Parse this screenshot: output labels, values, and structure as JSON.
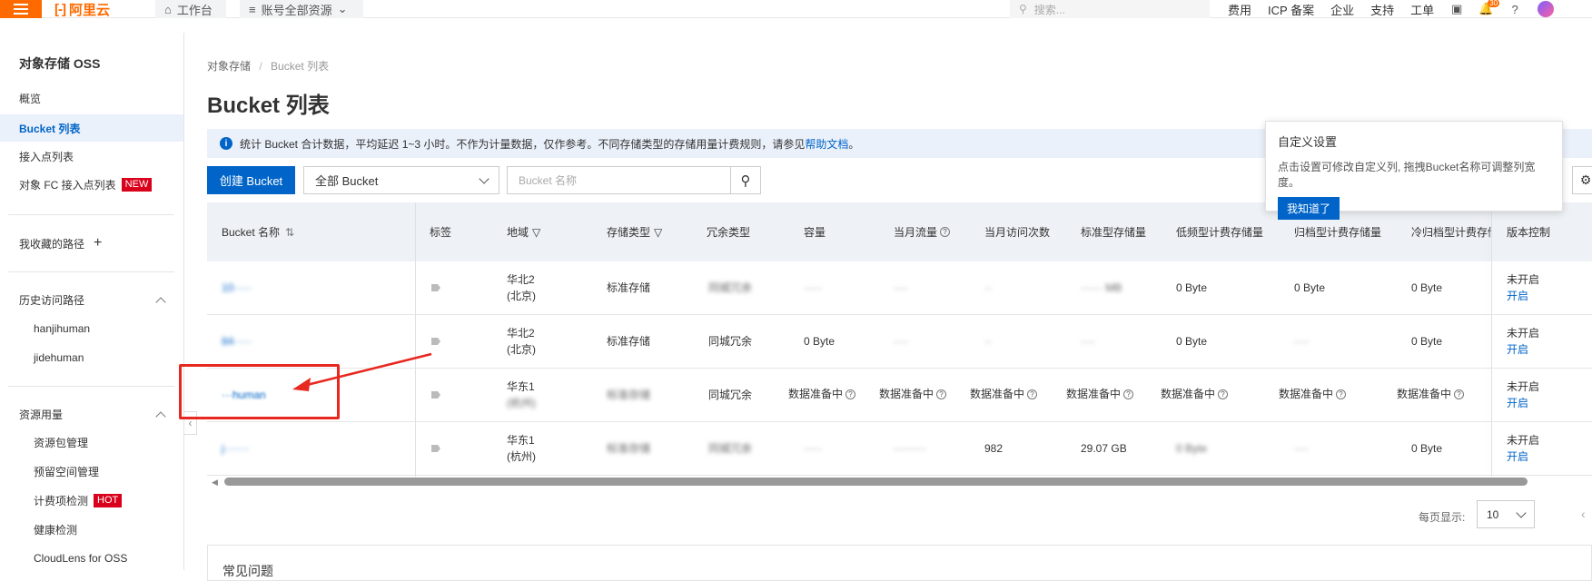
{
  "topbar": {
    "logo_text": "阿里云",
    "workbench": "工作台",
    "account_resources": "账号全部资源",
    "search_placeholder": "搜索...",
    "links": [
      "费用",
      "ICP 备案",
      "企业",
      "支持",
      "工单"
    ],
    "notification_count": "30"
  },
  "sidebar": {
    "title": "对象存储 OSS",
    "items": [
      "概览",
      "Bucket 列表",
      "接入点列表",
      "对象 FC 接入点列表"
    ],
    "new_tag": "NEW",
    "favorites": "我收藏的路径",
    "history_title": "历史访问路径",
    "history_items": [
      "hanjihuman",
      "jidehuman"
    ],
    "usage_title": "资源用量",
    "usage_items": [
      "资源包管理",
      "预留空间管理",
      "计费项检测",
      "健康检测",
      "CloudLens for OSS"
    ],
    "hot_tag": "HOT"
  },
  "main": {
    "breadcrumb": [
      "对象存储",
      "Bucket 列表"
    ],
    "title": "Bucket 列表",
    "info_text": "统计 Bucket 合计数据，平均延迟 1~3 小时。不作为计量数据，仅作参考。不同存储类型的存储用量计费规则，请参见",
    "info_link": "帮助文档",
    "info_tail": "。",
    "create_button": "创建 Bucket",
    "filter_select": "全部 Bucket",
    "search_placeholder": "Bucket 名称"
  },
  "table": {
    "headers": [
      "Bucket 名称",
      "标签",
      "地域",
      "存储类型",
      "冗余类型",
      "容量",
      "当月流量",
      "当月访问次数",
      "标准型存储量",
      "低频型计费存储量",
      "归档型计费存储量",
      "冷归档型计费存储",
      "版本控制"
    ],
    "rows": [
      {
        "name": "10·····",
        "region": [
          "华北2",
          "(北京)"
        ],
        "storage": "标准存储",
        "redundancy": "同城冗余",
        "capacity": "·····",
        "traffic": "····",
        "visits": "··",
        "standard": "······ MB",
        "ia": "0 Byte",
        "archive": "0 Byte",
        "cold": "0 Byte",
        "version_status": "未开启",
        "version_action": "开启"
      },
      {
        "name": "84·····",
        "region": [
          "华北2",
          "(北京)"
        ],
        "storage": "标准存储",
        "redundancy": "同城冗余",
        "capacity": "0 Byte",
        "traffic": "····",
        "visits": "··",
        "standard": "····",
        "ia": "0 Byte",
        "archive": "····",
        "cold": "0 Byte",
        "version_status": "未开启",
        "version_action": "开启"
      },
      {
        "name": "···human",
        "region": [
          "华东1",
          "(杭州)"
        ],
        "storage": "标准存储",
        "redundancy": "同城冗余",
        "capacity": "数据准备中",
        "traffic": "数据准备中",
        "visits": "数据准备中",
        "standard": "数据准备中",
        "ia": "数据准备中",
        "archive": "数据准备中",
        "cold": "数据准备中",
        "version_status": "未开启",
        "version_action": "开启"
      },
      {
        "name": "j·······",
        "region": [
          "华东1",
          "(杭州)"
        ],
        "storage": "标准存储",
        "redundancy": "同城冗余",
        "capacity": "·····",
        "traffic": "·········",
        "visits": "982",
        "standard": "29.07 GB",
        "ia": "0 Byte",
        "archive": "····",
        "cold": "0 Byte",
        "version_status": "未开启",
        "version_action": "开启"
      }
    ]
  },
  "popover": {
    "title": "自定义设置",
    "desc": "点击设置可修改自定义列, 拖拽Bucket名称可调整列宽度。",
    "button": "我知道了"
  },
  "pagination": {
    "label": "每页显示:",
    "page_size": "10"
  },
  "faq_title": "常见问题",
  "colors": {
    "brand": "#ff6a00",
    "primary": "#0064c8",
    "annotation": "#e8281e"
  }
}
